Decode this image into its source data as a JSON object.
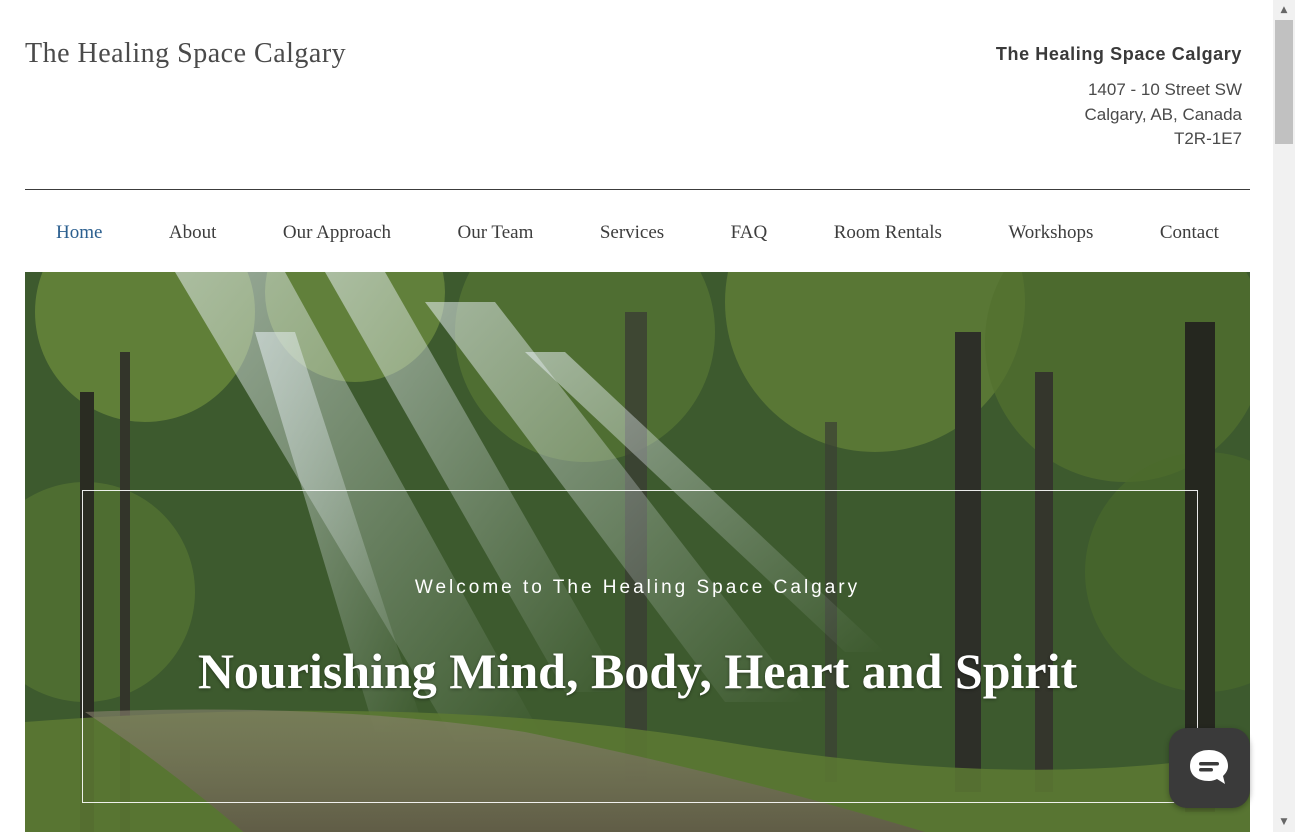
{
  "header": {
    "site_title": "The Healing Space Calgary",
    "contact_name": "The Healing Space Calgary",
    "address_line1": "1407 - 10 Street SW",
    "address_line2": "Calgary, AB, Canada",
    "address_line3": "T2R-1E7"
  },
  "nav": {
    "items": [
      {
        "label": "Home",
        "active": true
      },
      {
        "label": "About"
      },
      {
        "label": "Our Approach"
      },
      {
        "label": "Our Team"
      },
      {
        "label": "Services"
      },
      {
        "label": "FAQ"
      },
      {
        "label": "Room Rentals"
      },
      {
        "label": "Workshops"
      },
      {
        "label": "Contact"
      }
    ],
    "active_color": "#2b5f8f"
  },
  "hero": {
    "welcome": "Welcome to The Healing Space Calgary",
    "heading": "Nourishing Mind, Body, Heart and Spirit",
    "image": "forest-path-sunbeams"
  },
  "chat": {
    "icon": "chat-bubble-icon"
  },
  "scrollbar": {
    "up_arrow": "▲",
    "down_arrow": "▼"
  }
}
